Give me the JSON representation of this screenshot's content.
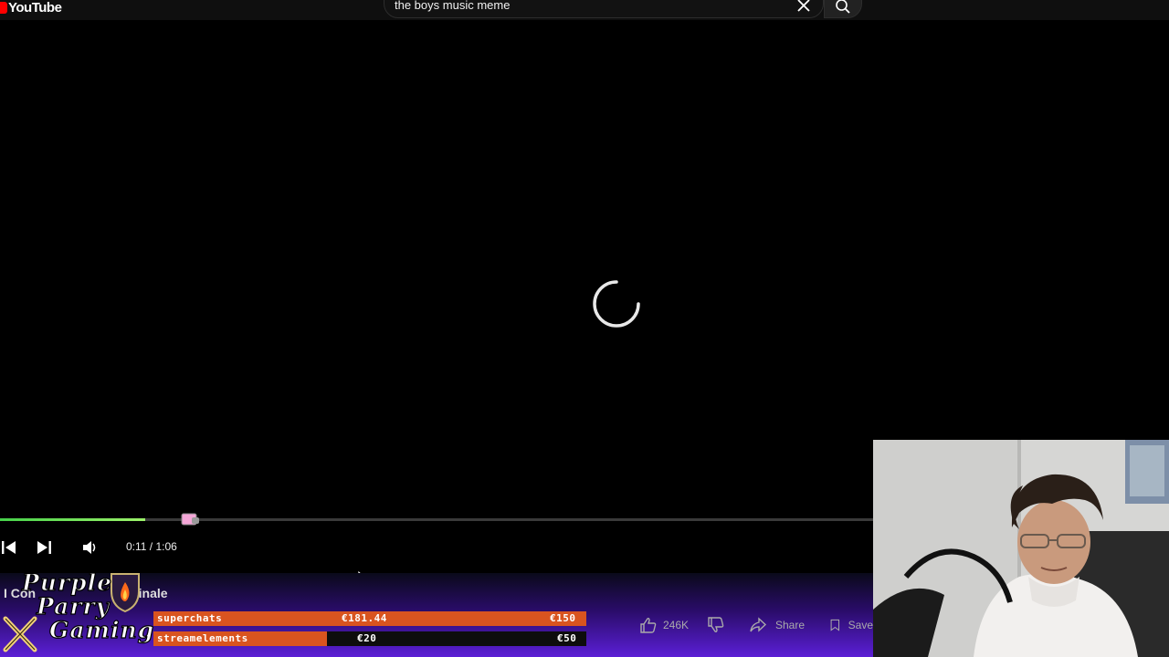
{
  "header": {
    "logo_text": "YouTube",
    "search_value": "the boys music meme"
  },
  "player": {
    "time": "0:11 / 1:06",
    "progress": 0.166
  },
  "video": {
    "title_visible": "I Con",
    "title_tail": "finale"
  },
  "overlay": {
    "watermark_line1": "Purple",
    "watermark_line2": "Parry",
    "watermark_line3": "Gaming",
    "goals": [
      {
        "name": "superchats",
        "current": "€181.44",
        "target": "€150",
        "fill": 1.0
      },
      {
        "name": "streamelements",
        "current": "€20",
        "target": "€50",
        "fill": 0.4
      }
    ]
  },
  "actions": {
    "likes": "246K",
    "share_label": "Share",
    "save_label": "Save"
  },
  "colors": {
    "brand": "#ff0000",
    "progress": "#46d14a",
    "goal_bar": "#d9541f"
  }
}
